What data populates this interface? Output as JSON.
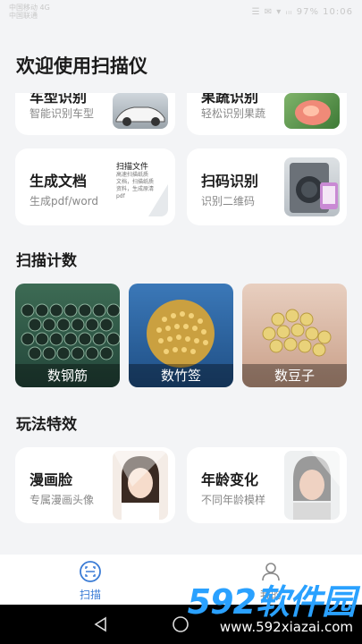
{
  "status": {
    "left_line1": "中国移动 4G",
    "left_line2": "中国联通",
    "right": "☰ ✉ ▾ ᵢₗₗ 97% 10:06"
  },
  "page_title": "欢迎使用扫描仪",
  "top_cards": [
    {
      "title": "车型识别",
      "sub": "智能识别车型"
    },
    {
      "title": "果蔬识别",
      "sub": "轻松识别果蔬"
    }
  ],
  "doc_card": {
    "title": "生成文档",
    "sub": "生成pdf/word",
    "thumb_title": "扫描文件",
    "thumb_lines": [
      "高速扫描纸质",
      "文档，扫描纸质",
      "资料，生成原清",
      "pdf"
    ]
  },
  "qr_card": {
    "title": "扫码识别",
    "sub": "识别二维码"
  },
  "section_count": "扫描计数",
  "count_tiles": [
    {
      "label": "数钢筋"
    },
    {
      "label": "数竹签"
    },
    {
      "label": "数豆子"
    }
  ],
  "section_fun": "玩法特效",
  "fun_cards": [
    {
      "title": "漫画脸",
      "sub": "专属漫画头像"
    },
    {
      "title": "年龄变化",
      "sub": "不同年龄模样"
    }
  ],
  "tabs": [
    {
      "label": "扫描",
      "active": true
    },
    {
      "label": "我的",
      "active": false
    }
  ],
  "watermark": {
    "brand": "592软件园",
    "url": "www.592xiazai.com"
  },
  "colors": {
    "accent": "#3a7bd5",
    "bg": "#f3f4f6",
    "card": "#ffffff",
    "watermark": "#2aa1ff"
  }
}
